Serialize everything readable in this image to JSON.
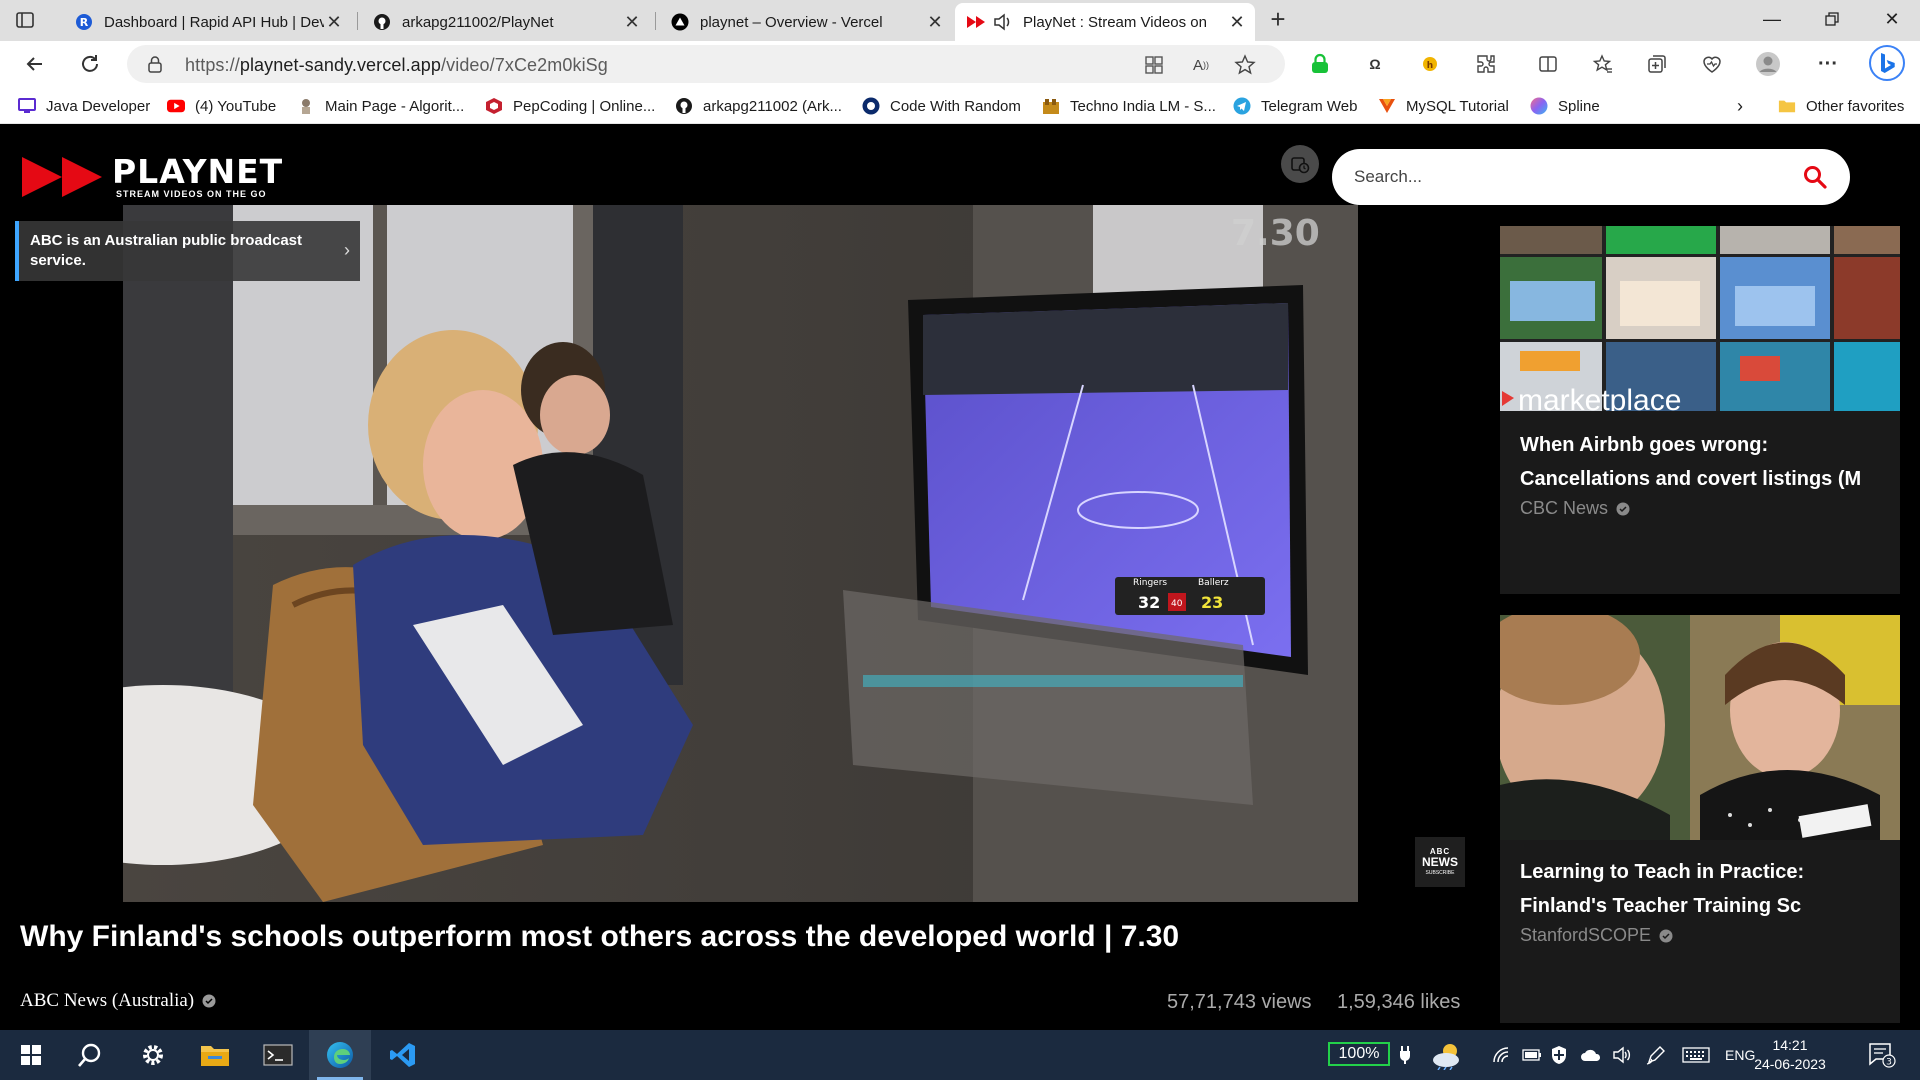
{
  "browser": {
    "tabs": [
      {
        "title": "Dashboard | Rapid API Hub | Dev",
        "icon": "rapidapi-icon",
        "active": false
      },
      {
        "title": "arkapg211002/PlayNet",
        "icon": "github-icon",
        "active": false
      },
      {
        "title": "playnet – Overview - Vercel",
        "icon": "vercel-icon",
        "active": false
      },
      {
        "title": "PlayNet : Stream Videos on",
        "icon": "playnet-icon",
        "active": true
      }
    ],
    "url_scheme": "https://",
    "url_host": "playnet-sandy.vercel.app",
    "url_path": "/video/7xCe2m0kiSg",
    "favorites": [
      {
        "label": "Java Developer",
        "icon": "java-icon"
      },
      {
        "label": "(4) YouTube",
        "icon": "youtube-icon"
      },
      {
        "label": "Main Page - Algorit...",
        "icon": "algorithms-icon"
      },
      {
        "label": "PepCoding | Online...",
        "icon": "pepcoding-icon"
      },
      {
        "label": "arkapg211002 (Ark...",
        "icon": "github-icon"
      },
      {
        "label": "Code With Random",
        "icon": "codewithrandom-icon"
      },
      {
        "label": "Techno India LM - S...",
        "icon": "technoindia-icon"
      },
      {
        "label": "Telegram Web",
        "icon": "telegram-icon"
      },
      {
        "label": "MySQL Tutorial",
        "icon": "mysql-icon"
      },
      {
        "label": "Spline",
        "icon": "spline-icon"
      }
    ],
    "other_favorites": "Other favorites"
  },
  "app": {
    "logo_name": "PLAYNET",
    "logo_tagline": "STREAM VIDEOS ON THE GO",
    "search_placeholder": "Search...",
    "accent_color": "#e50914",
    "info_card": "ABC is an Australian public broadcast service.",
    "video_watermark": "7.30",
    "news_badge_abc": "ABC",
    "news_badge_text": "NEWS",
    "news_badge_sub": "SUBSCRIBE",
    "video": {
      "title": "Why Finland's schools outperform most others across the developed world | 7.30",
      "channel": "ABC News (Australia)",
      "views": "57,71,743 views",
      "likes": "1,59,346 likes",
      "scoreboard_left_team": "Ringers",
      "scoreboard_right_team": "Ballerz",
      "scoreboard_left_score": "32",
      "scoreboard_right_score": "23",
      "scoreboard_clock": "40"
    },
    "related": [
      {
        "title": "When Airbnb goes wrong: Cancellations and covert listings (M",
        "channel": "CBC News",
        "thumb_text": "marketplace"
      },
      {
        "title": "Learning to Teach in Practice: Finland's Teacher Training Sc",
        "channel": "StanfordSCOPE"
      }
    ]
  },
  "taskbar": {
    "apps": [
      {
        "name": "start-icon"
      },
      {
        "name": "search-icon"
      },
      {
        "name": "settings-icon"
      },
      {
        "name": "file-explorer-icon"
      },
      {
        "name": "terminal-icon"
      },
      {
        "name": "edge-icon"
      },
      {
        "name": "vscode-icon"
      }
    ],
    "battery": "100%",
    "language": "ENG",
    "time": "14:21",
    "date": "24-06-2023",
    "notifications": "3"
  }
}
